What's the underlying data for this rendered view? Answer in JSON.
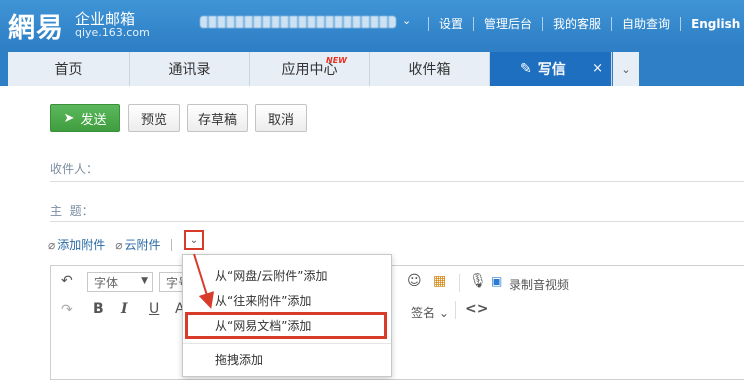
{
  "header": {
    "logo_main": "網易",
    "logo_sub_top": "企业邮箱",
    "logo_sub_bottom": "qiye.163.com",
    "links": [
      "设置",
      "管理后台",
      "我的客服",
      "自助查询",
      "English"
    ]
  },
  "tabs": {
    "items": [
      "首页",
      "通讯录",
      "应用中心",
      "收件箱"
    ],
    "new_badge": "NEW",
    "active": "写信",
    "close_symbol": "×",
    "more_symbol": "⌄"
  },
  "toolbar": {
    "send": "发送",
    "preview": "预览",
    "draft": "存草稿",
    "cancel": "取消"
  },
  "fields": {
    "recipient": "收件人：",
    "subject": "主  题："
  },
  "attach": {
    "add_attachment": "添加附件",
    "cloud_attachment": "云附件"
  },
  "editor": {
    "font_family": "字体",
    "font_size": "字号",
    "signature": "签名",
    "record_av": "录制音视频"
  },
  "dropdown": {
    "items": [
      "从“网盘/云附件”添加",
      "从“往来附件”添加",
      "从“网易文档”添加",
      "拖拽添加"
    ]
  },
  "colors": {
    "header_blue": "#2f7fc6",
    "send_green": "#4cae4c",
    "highlight_red": "#d83b2a"
  }
}
